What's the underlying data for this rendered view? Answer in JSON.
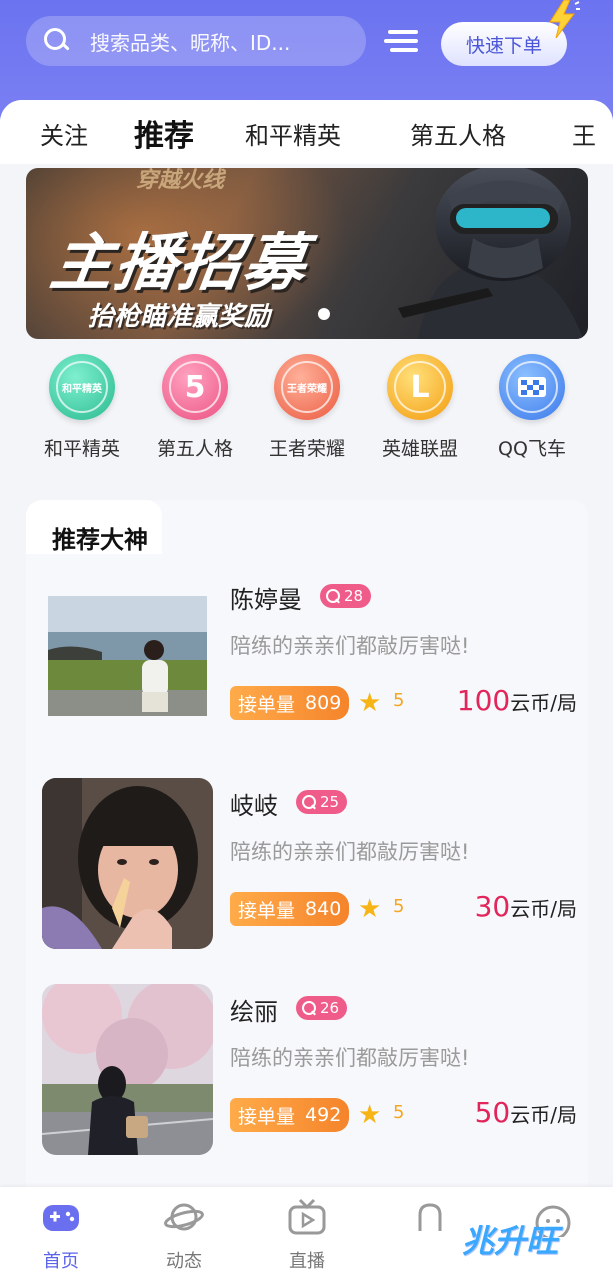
{
  "header": {
    "search_placeholder": "搜索品类、昵称、ID...",
    "quick_order_label": "快速下单"
  },
  "tabs": [
    {
      "label": "关注",
      "active": false
    },
    {
      "label": "推荐",
      "active": true
    },
    {
      "label": "和平精英",
      "active": false
    },
    {
      "label": "第五人格",
      "active": false
    },
    {
      "label": "王",
      "active": false
    }
  ],
  "banner": {
    "logo_text": "穿越火线",
    "title": "主播招募",
    "subtitle": "抬枪瞄准赢奖励"
  },
  "games": [
    {
      "label": "和平精英",
      "icon_text": "和平精英",
      "color": "#3cc7a0",
      "icon": "peace-elite-icon"
    },
    {
      "label": "第五人格",
      "icon_text": "5",
      "color": "#f2658f",
      "icon": "identity-v-icon"
    },
    {
      "label": "王者荣耀",
      "icon_text": "王者荣耀",
      "color": "#f0745a",
      "icon": "honor-of-kings-icon"
    },
    {
      "label": "英雄联盟",
      "icon_text": "L",
      "color": "#f7a81c",
      "icon": "lol-icon"
    },
    {
      "label": "QQ飞车",
      "icon_text": "",
      "color": "#4b8ff2",
      "icon": "qq-speed-icon"
    }
  ],
  "section": {
    "title": "推荐大神"
  },
  "players": [
    {
      "name": "陈婷曼",
      "level": "28",
      "desc": "陪练的亲亲们都敲厉害哒!",
      "orders_label": "接单量",
      "orders": "809",
      "rating": "5",
      "price": "100",
      "unit": "云币/局"
    },
    {
      "name": "岐岐",
      "level": "25",
      "desc": "陪练的亲亲们都敲厉害哒!",
      "orders_label": "接单量",
      "orders": "840",
      "rating": "5",
      "price": "30",
      "unit": "云币/局"
    },
    {
      "name": "绘丽",
      "level": "26",
      "desc": "陪练的亲亲们都敲厉害哒!",
      "orders_label": "接单量",
      "orders": "492",
      "rating": "5",
      "price": "50",
      "unit": "云币/局"
    }
  ],
  "nav": [
    {
      "label": "首页",
      "icon": "gamepad-icon",
      "active": true
    },
    {
      "label": "动态",
      "icon": "planet-icon",
      "active": false
    },
    {
      "label": "直播",
      "icon": "tv-icon",
      "active": false
    },
    {
      "label": "",
      "icon": "message-icon",
      "active": false
    },
    {
      "label": "",
      "icon": "profile-icon",
      "active": false
    }
  ],
  "watermark": "兆升旺"
}
